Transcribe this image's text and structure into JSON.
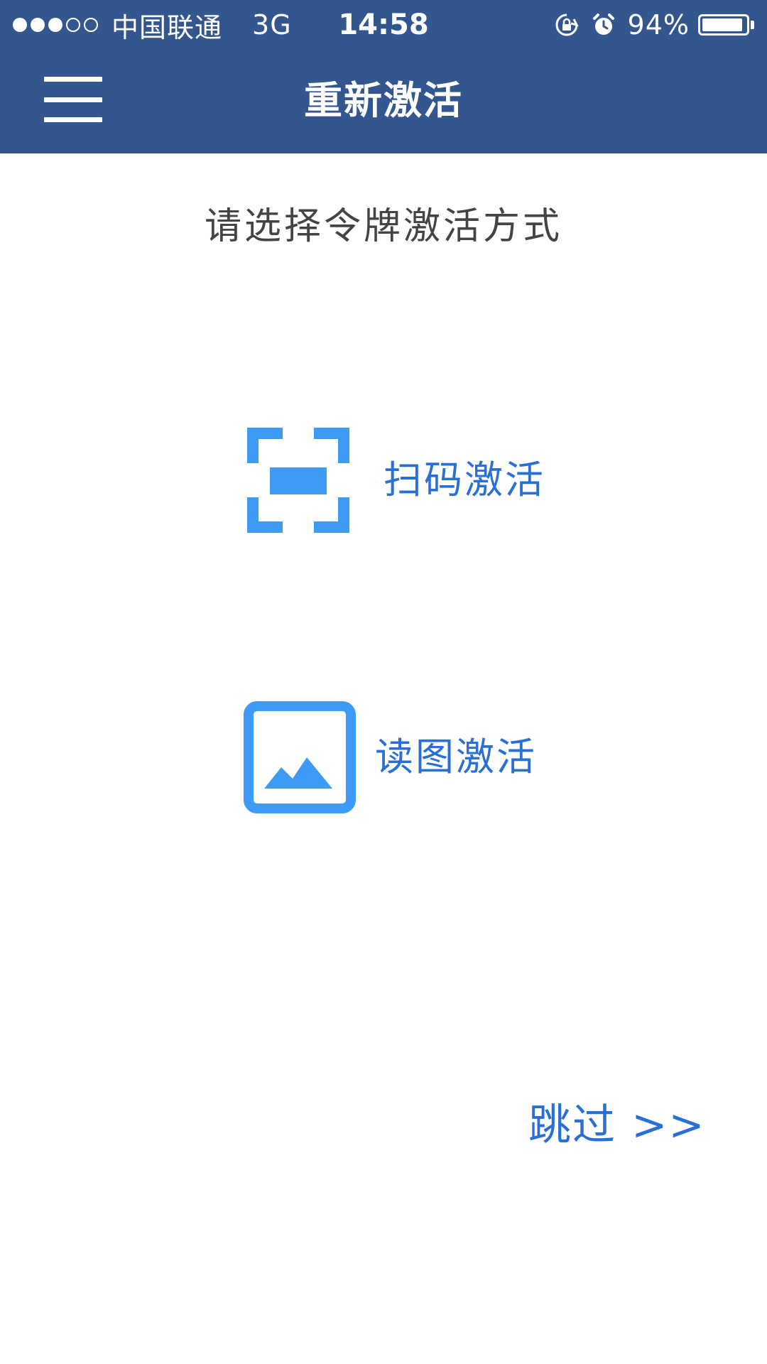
{
  "status_bar": {
    "signal_filled": 3,
    "signal_total": 5,
    "carrier": "中国联通",
    "network": "3G",
    "time": "14:58",
    "battery_percent_text": "94%",
    "battery_level": 0.94
  },
  "nav": {
    "title": "重新激活",
    "menu_icon": "hamburger-menu-icon"
  },
  "content": {
    "subtitle": "请选择令牌激活方式",
    "options": [
      {
        "label": "扫码激活",
        "icon": "scan-qr-icon"
      },
      {
        "label": "读图激活",
        "icon": "image-icon"
      }
    ],
    "skip_label": "跳过 >>"
  },
  "colors": {
    "header_bg": "#34568f",
    "accent": "#2a6fd6",
    "icon_blue": "#3e9bf5",
    "subtitle_text": "#444444"
  }
}
